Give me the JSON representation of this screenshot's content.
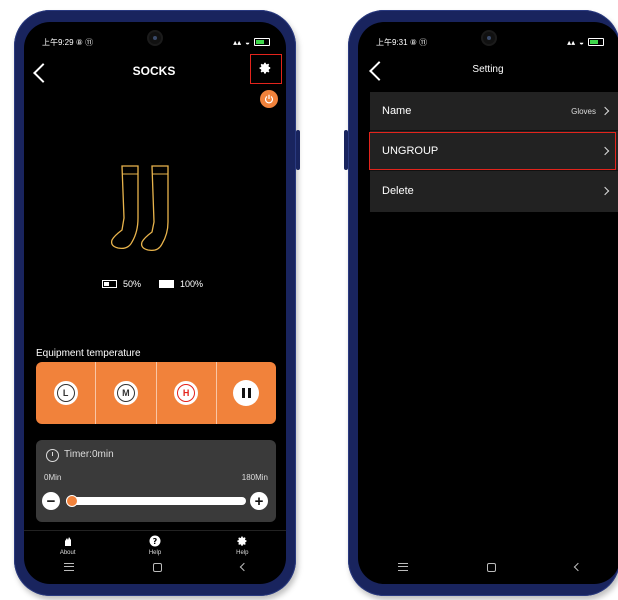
{
  "left_screen": {
    "status_time": "上午9:29 ⑧ ⑪",
    "title": "SOCKS",
    "battery_left": "50%",
    "battery_right": "100%",
    "equipment_label": "Equipment temperature",
    "temp_buttons": [
      "L",
      "M",
      "H"
    ],
    "timer_label": "Timer:0min",
    "timer_min": "0Min",
    "timer_max": "180Min",
    "minus": "−",
    "plus": "+",
    "tabs": [
      {
        "label": "About",
        "icon": "hand-heat-icon"
      },
      {
        "label": "Help",
        "icon": "question-icon"
      },
      {
        "label": "Help",
        "icon": "gear-icon"
      }
    ]
  },
  "right_screen": {
    "status_time": "上午9:31 ⑧ ⑪",
    "title": "Setting",
    "rows": [
      {
        "label": "Name",
        "value": "Gloves"
      },
      {
        "label": "UNGROUP",
        "value": ""
      },
      {
        "label": "Delete",
        "value": ""
      }
    ]
  },
  "colors": {
    "accent": "#f1823b",
    "highlight": "#e3241c",
    "phone_frame": "#19245e"
  }
}
